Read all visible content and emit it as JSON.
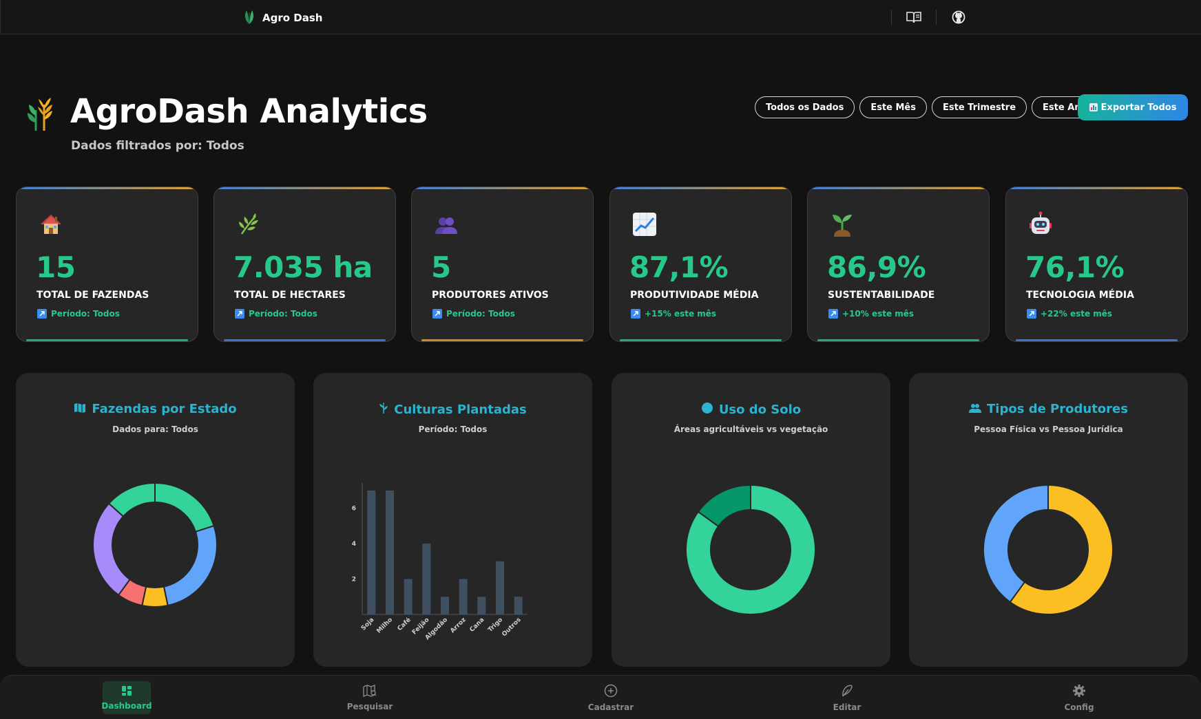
{
  "app": {
    "name": "Agro Dash",
    "icons": [
      "leaf-logo-icon",
      "docs-book-icon",
      "github-icon"
    ]
  },
  "header": {
    "title": "AgroDash Analytics",
    "subtitle": "Dados filtrados por: Todos",
    "logo_icon": "wheat-logo-icon"
  },
  "filters": [
    {
      "label": "Todos os Dados"
    },
    {
      "label": "Este Mês"
    },
    {
      "label": "Este Trimestre"
    },
    {
      "label": "Este Ano"
    }
  ],
  "export_button": {
    "label": "Exportar Todos",
    "icon": "bar-chart-icon"
  },
  "stats": [
    {
      "icon": "house-icon",
      "value": "15",
      "label": "TOTAL DE FAZENDAS",
      "trend": "Período: Todos",
      "bottom_color": "#1fae7a"
    },
    {
      "icon": "herb-icon",
      "value": "7.035 ha",
      "label": "TOTAL DE HECTARES",
      "trend": "Período: Todos",
      "bottom_color": "#3f6fd0"
    },
    {
      "icon": "people-icon",
      "value": "5",
      "label": "PRODUTORES ATIVOS",
      "trend": "Período: Todos",
      "bottom_color": "#d08a20"
    },
    {
      "icon": "chart-up-icon",
      "value": "87,1%",
      "label": "PRODUTIVIDADE MÉDIA",
      "trend": "+15% este mês",
      "bottom_color": "#1fae7a"
    },
    {
      "icon": "seedling-icon",
      "value": "86,9%",
      "label": "SUSTENTABILIDADE",
      "trend": "+10% este mês",
      "bottom_color": "#1fae7a"
    },
    {
      "icon": "robot-icon",
      "value": "76,1%",
      "label": "TECNOLOGIA MÉDIA",
      "trend": "+22% este mês",
      "bottom_color": "#3f6fd0"
    }
  ],
  "charts": {
    "estado": {
      "title": "Fazendas por Estado",
      "subtitle": "Dados para: Todos",
      "icon": "map-icon"
    },
    "culturas": {
      "title": "Culturas Plantadas",
      "subtitle": "Período: Todos",
      "icon": "plant-icon"
    },
    "solo": {
      "title": "Uso do Solo",
      "subtitle": "Áreas agricultáveis vs vegetação",
      "icon": "circle-icon"
    },
    "produtores": {
      "title": "Tipos de Produtores",
      "subtitle": "Pessoa Física vs Pessoa Jurídica",
      "icon": "users-icon"
    }
  },
  "chart_data": [
    {
      "type": "pie",
      "title": "Fazendas por Estado",
      "values": [
        3,
        4,
        1,
        1,
        4,
        2
      ],
      "colors": [
        "#34d399",
        "#60a5fa",
        "#fbbf24",
        "#f87171",
        "#a78bfa",
        "#34d399"
      ]
    },
    {
      "type": "bar",
      "title": "Culturas Plantadas",
      "categories": [
        "Soja",
        "Milho",
        "Café",
        "Feijão",
        "Algodão",
        "Arroz",
        "Cana",
        "Trigo",
        "Outros"
      ],
      "values": [
        7,
        7,
        2,
        4,
        1,
        2,
        1,
        3,
        1
      ],
      "yticks": [
        2,
        4,
        6
      ],
      "ylim": [
        0,
        7.5
      ],
      "color": "#3f5161"
    },
    {
      "type": "pie",
      "title": "Uso do Solo",
      "values": [
        85,
        15
      ],
      "colors": [
        "#34d399",
        "#059669"
      ]
    },
    {
      "type": "pie",
      "title": "Tipos de Produtores",
      "values": [
        60,
        40
      ],
      "colors": [
        "#fbbf24",
        "#60a5fa"
      ]
    }
  ],
  "bottom_nav": [
    {
      "label": "Dashboard",
      "icon": "grid-icon",
      "active": true
    },
    {
      "label": "Pesquisar",
      "icon": "map-search-icon",
      "active": false
    },
    {
      "label": "Cadastrar",
      "icon": "plus-circle-icon",
      "active": false
    },
    {
      "label": "Editar",
      "icon": "edit-leaf-icon",
      "active": false
    },
    {
      "label": "Config",
      "icon": "gear-icon",
      "active": false
    }
  ]
}
